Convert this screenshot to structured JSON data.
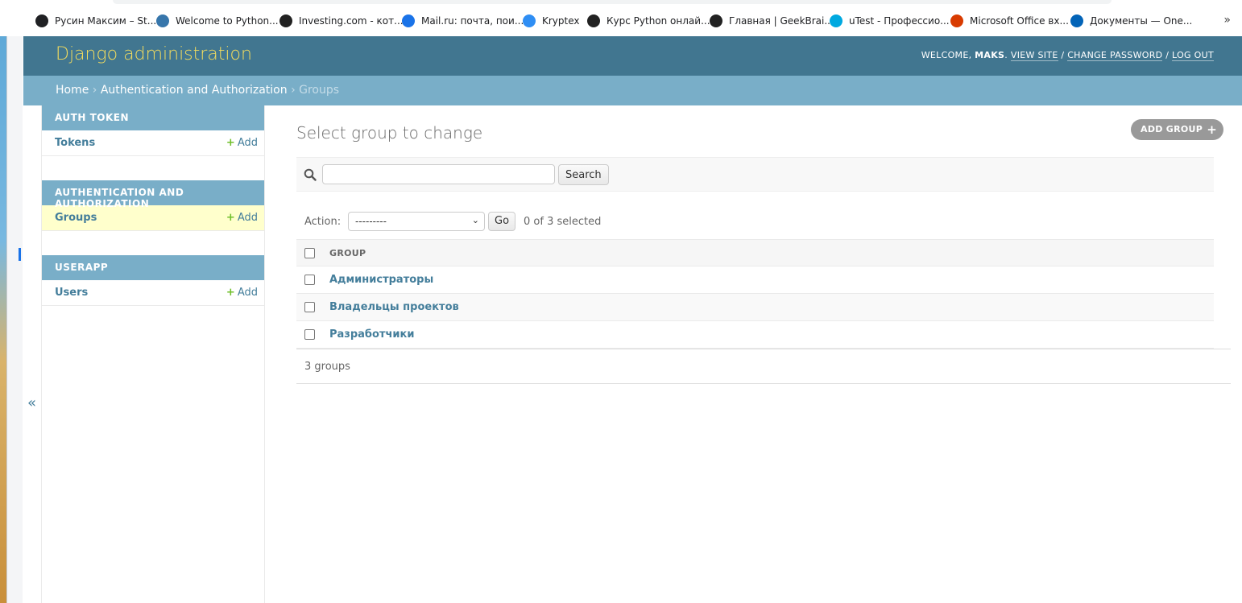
{
  "bookmarks": [
    {
      "label": "Русин Максим – St...",
      "icon": "dark-circle-icon",
      "color": "#202124"
    },
    {
      "label": "Welcome to Python...",
      "icon": "python-icon",
      "color": "#3776ab"
    },
    {
      "label": "Investing.com - кот...",
      "icon": "investing-icon",
      "color": "#222222"
    },
    {
      "label": "Mail.ru: почта, пои...",
      "icon": "mailru-icon",
      "color": "#1a73e8"
    },
    {
      "label": "Kryptex",
      "icon": "diamond-icon",
      "color": "#2f8ef4"
    },
    {
      "label": "Курс Python онлай...",
      "icon": "geekbrains-icon",
      "color": "#222222"
    },
    {
      "label": "Главная | GeekBrai...",
      "icon": "geekbrains-icon",
      "color": "#222222"
    },
    {
      "label": "uTest - Профессио...",
      "icon": "utest-icon",
      "color": "#00a9e0"
    },
    {
      "label": "Microsoft Office вх...",
      "icon": "office-icon",
      "color": "#d83b01"
    },
    {
      "label": "Документы — One...",
      "icon": "onedrive-icon",
      "color": "#0364b8"
    }
  ],
  "header": {
    "branding": "Django administration",
    "welcome": "WELCOME, ",
    "username": "MAKS",
    "view_site": "VIEW SITE",
    "change_password": "CHANGE PASSWORD",
    "log_out": "LOG OUT",
    "separator": " / "
  },
  "breadcrumbs": {
    "home": "Home",
    "app": "Authentication and Authorization",
    "current": "Groups",
    "sep": " › "
  },
  "sidebar": {
    "toggle": "«",
    "modules": [
      {
        "caption": "AUTH TOKEN",
        "items": [
          {
            "name": "Tokens",
            "add": "Add",
            "current": false
          }
        ]
      },
      {
        "caption": "AUTHENTICATION AND AUTHORIZATION",
        "items": [
          {
            "name": "Groups",
            "add": "Add",
            "current": true
          }
        ]
      },
      {
        "caption": "USERAPP",
        "items": [
          {
            "name": "Users",
            "add": "Add",
            "current": false
          }
        ]
      }
    ]
  },
  "content": {
    "title": "Select group to change",
    "add_button": "ADD GROUP",
    "search": {
      "button": "Search",
      "value": ""
    },
    "actions": {
      "label": "Action:",
      "selected": "---------",
      "go": "Go",
      "counter": "0 of 3 selected"
    },
    "table": {
      "column": "GROUP",
      "rows": [
        "Администраторы",
        "Владельцы проектов",
        "Разработчики"
      ]
    },
    "paginator": "3 groups"
  },
  "colors": {
    "header_bg": "#417690",
    "branding": "#f5dd5d",
    "breadcrumbs_bg": "#79aec8",
    "link": "#447e9b",
    "current_row": "#ffffcc",
    "add_green": "#70bf2b"
  }
}
